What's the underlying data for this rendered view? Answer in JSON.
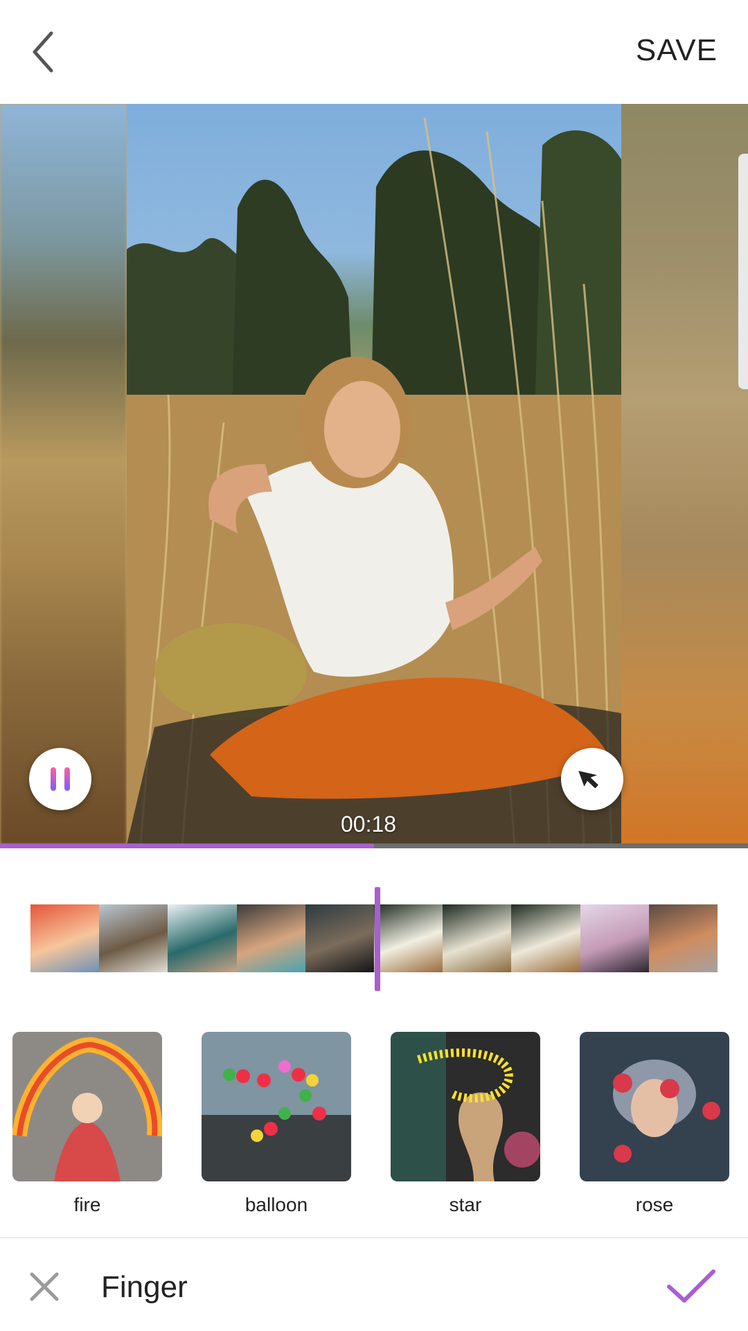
{
  "header": {
    "save_label": "SAVE",
    "back_icon": "chevron-left-icon"
  },
  "player": {
    "time": "00:18",
    "progress_fraction": 0.5,
    "pause_icon": "pause-icon",
    "pointer_icon": "cursor-arrow-icon"
  },
  "timeline": {
    "frames": [
      {
        "colors": [
          "#e6543a",
          "#f6c59b",
          "#6d91b8"
        ]
      },
      {
        "colors": [
          "#b9c6d0",
          "#6d5a45",
          "#e0ded6"
        ]
      },
      {
        "colors": [
          "#e9f0f3",
          "#2a6a6a",
          "#c9a184"
        ]
      },
      {
        "colors": [
          "#3b3b3b",
          "#d6a57e",
          "#4aa3b0"
        ]
      },
      {
        "colors": [
          "#2d3b40",
          "#7b6c5b",
          "#121417"
        ]
      },
      {
        "colors": [
          "#1f2b20",
          "#f0efe2",
          "#9a6b3b"
        ]
      },
      {
        "colors": [
          "#1e2a22",
          "#e6e2d2",
          "#8a6a3c"
        ]
      },
      {
        "colors": [
          "#1f2b20",
          "#ece8da",
          "#9a6b3b"
        ]
      },
      {
        "colors": [
          "#e6d6e8",
          "#c49bb6",
          "#2b2430"
        ]
      },
      {
        "colors": [
          "#5c4a44",
          "#cf8d60",
          "#a5a1a0"
        ]
      }
    ],
    "playhead_fraction": 0.5
  },
  "effects": [
    {
      "label": "fire",
      "colors": [
        "#ffb22e",
        "#e84c2a",
        "#8f8f8f"
      ]
    },
    {
      "label": "balloon",
      "colors": [
        "#6e8796",
        "#ef2f47",
        "#3f6a4f"
      ]
    },
    {
      "label": "star",
      "colors": [
        "#2b2c2b",
        "#ffe12a",
        "#7a2f3a"
      ]
    },
    {
      "label": "rose",
      "colors": [
        "#2f3a49",
        "#d9394a",
        "#7e8aa0"
      ]
    }
  ],
  "footer": {
    "mode_title": "Finger",
    "close_icon": "close-icon",
    "confirm_icon": "checkmark-icon",
    "accent": "#a95ed1"
  }
}
